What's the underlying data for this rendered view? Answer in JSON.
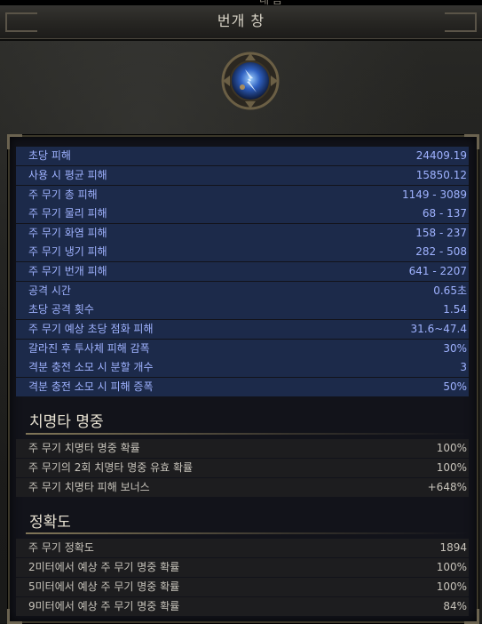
{
  "window": {
    "top_strip_text": "내 금",
    "title": "번개 창"
  },
  "emblem": {
    "icon": "lightning-spear-skill-icon"
  },
  "colors": {
    "blue_row_bg": "#1c2a4a",
    "blue_text": "#9fb2ff",
    "gray_text": "#c8c4bb",
    "accent_underline": "#c9b87a"
  },
  "main_stats": [
    {
      "label": "초당 피해",
      "value": "24409.19"
    },
    {
      "label": "사용 시 평균 피해",
      "value": "15850.12"
    },
    {
      "label": "주 무기 총 피해",
      "value": "1149 - 3089"
    },
    {
      "label": "주 무기 물리 피해",
      "value": "68 - 137"
    },
    {
      "label": "주 무기 화염 피해",
      "value": "158 - 237"
    },
    {
      "label": "주 무기 냉기 피해",
      "value": "282 - 508"
    },
    {
      "label": "주 무기 번개 피해",
      "value": "641 - 2207"
    },
    {
      "label": "공격 시간",
      "value": "0.65초"
    },
    {
      "label": "초당 공격 횟수",
      "value": "1.54"
    },
    {
      "label": "주 무기 예상 초당 점화 피해",
      "value": "31.6~47.4"
    },
    {
      "label": "갈라진 후 투사체 피해 감폭",
      "value": "30%"
    },
    {
      "label": "격분 충전 소모 시 분할 개수",
      "value": "3"
    },
    {
      "label": "격분 충전 소모 시 피해 증폭",
      "value": "50%"
    }
  ],
  "crit_section": {
    "title": "치명타 명중",
    "rows": [
      {
        "label": "주 무기 치명타 명중 확률",
        "value": "100%"
      },
      {
        "label": "주 무기의 2회 치명타 명중 유효 확률",
        "value": "100%"
      },
      {
        "label": "주 무기 치명타 피해 보너스",
        "value": "+648%"
      }
    ]
  },
  "accuracy_section": {
    "title": "정확도",
    "rows": [
      {
        "label": "주 무기 정확도",
        "value": "1894"
      },
      {
        "label": "2미터에서 예상 주 무기 명중 확률",
        "value": "100%"
      },
      {
        "label": "5미터에서 예상 주 무기 명중 확률",
        "value": "100%"
      },
      {
        "label": "9미터에서 예상 주 무기 명중 확률",
        "value": "84%"
      }
    ]
  }
}
